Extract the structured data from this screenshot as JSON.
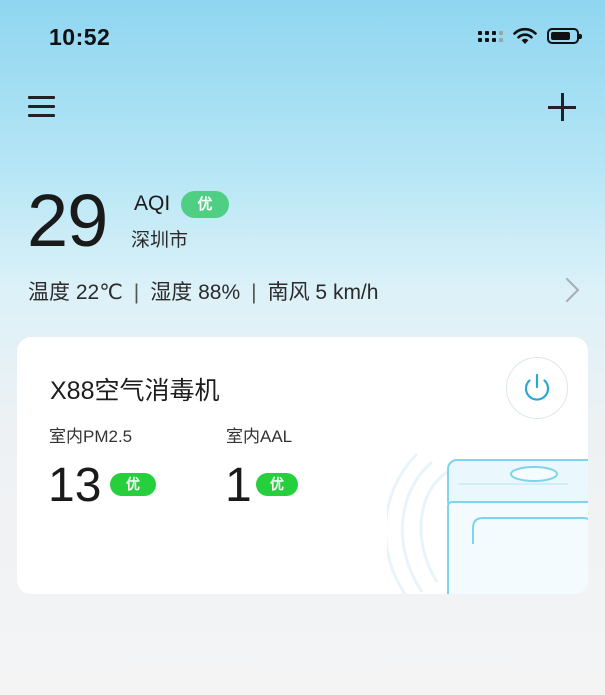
{
  "status_bar": {
    "time": "10:52",
    "icons": [
      "cellular-signal-icon",
      "wifi-icon",
      "battery-icon"
    ]
  },
  "header": {
    "icons": [
      "menu-icon",
      "plus-icon"
    ]
  },
  "air_quality": {
    "aqi_value": "29",
    "aqi_label": "AQI",
    "aqi_level": "优",
    "city": "深圳市",
    "temperature": "温度 22℃",
    "humidity": "湿度 88%",
    "wind": "南风 5 km/h",
    "separator": "|"
  },
  "device_card": {
    "name": "X88空气消毒机",
    "metrics": [
      {
        "label": "室内PM2.5",
        "value": "13",
        "level": "优"
      },
      {
        "label": "室内AAL",
        "value": "1",
        "level": "优"
      }
    ],
    "icons": [
      "power-icon",
      "air-purifier-illustration"
    ]
  },
  "colors": {
    "good_badge": "#4fcf83",
    "metric_badge": "#25d03c",
    "power_accent": "#2aa6d8",
    "sky_top": "#8fd6f0"
  }
}
